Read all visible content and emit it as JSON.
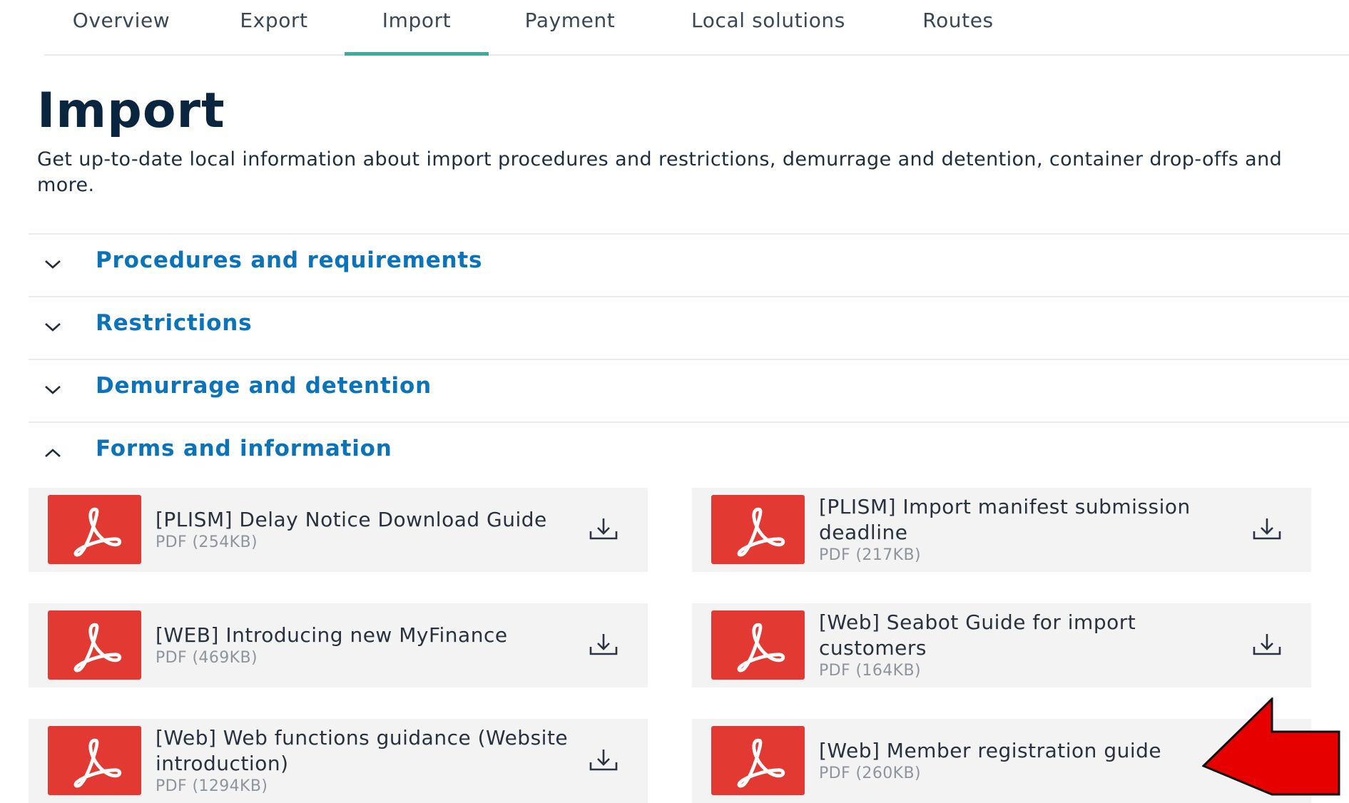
{
  "tabs": [
    {
      "label": "Overview",
      "active": false
    },
    {
      "label": "Export",
      "active": false
    },
    {
      "label": "Import",
      "active": true
    },
    {
      "label": "Payment",
      "active": false
    },
    {
      "label": "Local solutions",
      "active": false
    },
    {
      "label": "Routes",
      "active": false
    }
  ],
  "page": {
    "title": "Import",
    "description": "Get up-to-date local information about import procedures and restrictions, demurrage and detention, container drop-offs and more."
  },
  "accordions": [
    {
      "label": "Procedures and requirements",
      "expanded": false
    },
    {
      "label": "Restrictions",
      "expanded": false
    },
    {
      "label": "Demurrage and detention",
      "expanded": false
    },
    {
      "label": "Forms and information",
      "expanded": true
    }
  ],
  "files": [
    {
      "name": "[PLISM] Delay Notice Download Guide",
      "meta": "PDF (254KB)",
      "icon": "pdf-icon"
    },
    {
      "name": "[PLISM] Import manifest submission deadline",
      "meta": "PDF (217KB)",
      "icon": "pdf-icon"
    },
    {
      "name": "[WEB] Introducing new MyFinance",
      "meta": "PDF (469KB)",
      "icon": "pdf-icon"
    },
    {
      "name": "[Web] Seabot Guide for import customers",
      "meta": "PDF (164KB)",
      "icon": "pdf-icon"
    },
    {
      "name": "[Web] Web functions guidance (Website introduction)",
      "meta": "PDF (1294KB)",
      "icon": "pdf-icon"
    },
    {
      "name": "[Web] Member registration guide",
      "meta": "PDF (260KB)",
      "icon": "pdf-icon"
    }
  ],
  "colors": {
    "accent_tab": "#40ab9a",
    "link_blue": "#0b73ba",
    "pdf_red": "#e23a32",
    "arrow_red": "#e60000"
  }
}
